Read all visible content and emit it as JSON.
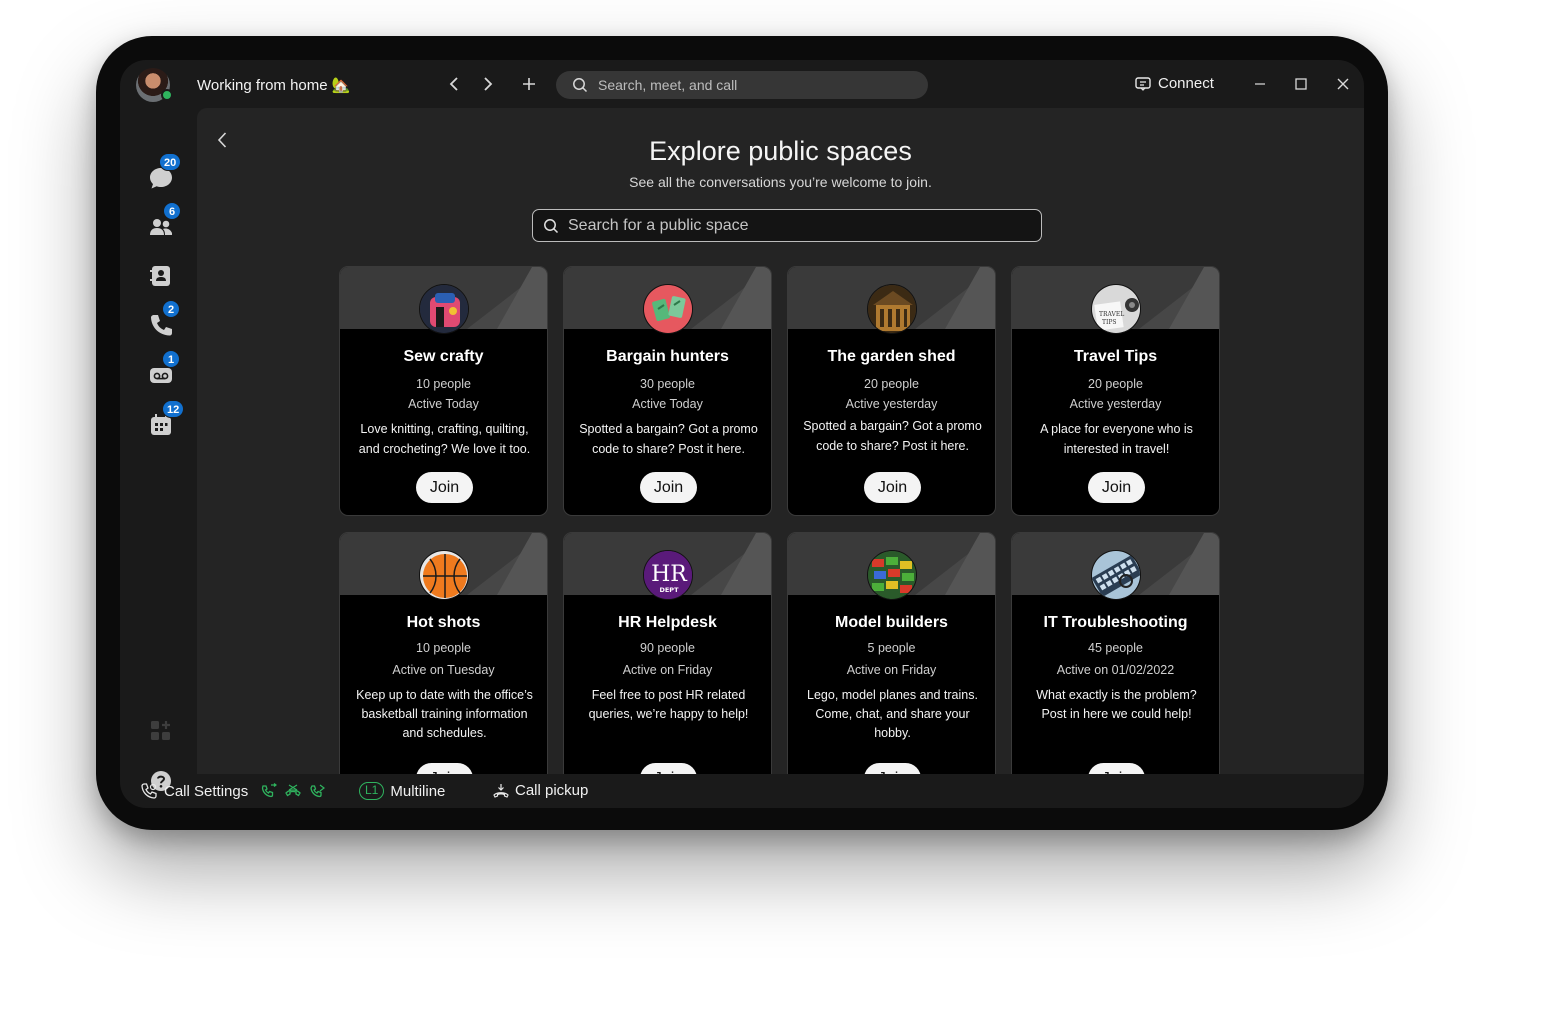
{
  "titlebar": {
    "status": "Working from home 🏡",
    "search_placeholder": "Search, meet, and call",
    "connect_label": "Connect"
  },
  "sidebar": {
    "items": [
      {
        "name": "messaging",
        "icon": "chat-icon",
        "badge": "20"
      },
      {
        "name": "teams",
        "icon": "people-icon",
        "badge": "6"
      },
      {
        "name": "contacts",
        "icon": "contacts-icon",
        "badge": ""
      },
      {
        "name": "calling",
        "icon": "phone-icon",
        "badge": "2"
      },
      {
        "name": "voicemail",
        "icon": "voicemail-icon",
        "badge": "1"
      },
      {
        "name": "meetings",
        "icon": "calendar-icon",
        "badge": "12"
      }
    ],
    "bottom": [
      {
        "name": "apps",
        "icon": "apps-icon"
      },
      {
        "name": "help",
        "icon": "help-icon"
      }
    ]
  },
  "main": {
    "title": "Explore public spaces",
    "subtitle": "See all the conversations you’re welcome to join.",
    "search_placeholder": "Search for a public space",
    "join_label": "Join",
    "spaces": [
      {
        "name": "Sew crafty",
        "people": "10 people",
        "active": "Active Today",
        "desc": "Love knitting, crafting, quilting, and crocheting? We love it too.",
        "icon": "sewing-machine-icon"
      },
      {
        "name": "Bargain hunters",
        "people": "30 people",
        "active": "Active Today",
        "desc": "Spotted a bargain? Got a promo code to share? Post it here.",
        "icon": "shopping-icon"
      },
      {
        "name": "The garden shed",
        "people": "20 people",
        "active": "Active yesterday",
        "desc": "Spotted a bargain? Got a promo code to share? Post it here.",
        "icon": "shed-icon"
      },
      {
        "name": "Travel Tips",
        "people": "20 people",
        "active": "Active yesterday",
        "desc": "A place for everyone who is interested in travel!",
        "icon": "travel-icon"
      },
      {
        "name": "Hot shots",
        "people": "10 people",
        "active": "Active on Tuesday",
        "desc": "Keep up to date with the office’s basketball training information and schedules.",
        "icon": "basketball-icon"
      },
      {
        "name": "HR Helpdesk",
        "people": "90 people",
        "active": "Active on Friday",
        "desc": "Feel free to post HR related queries, we’re happy to help!",
        "icon": "hr-dept-icon"
      },
      {
        "name": "Model builders",
        "people": "5 people",
        "active": "Active on Friday",
        "desc": "Lego, model planes and trains. Come, chat, and share your hobby.",
        "icon": "lego-icon"
      },
      {
        "name": "IT Troubleshooting",
        "people": "45 people",
        "active": "Active on 01/02/2022",
        "desc": "What exactly is the problem? Post in here we could help!",
        "icon": "keyboard-icon"
      }
    ],
    "hr_logo": {
      "big": "HR",
      "small": "DEPT"
    },
    "travel_logo": {
      "line1": "TRAVEL",
      "line2": "TIPS"
    }
  },
  "bottombar": {
    "call_settings": "Call Settings",
    "line_badge": "L1",
    "multiline": "Multiline",
    "call_pickup": "Call pickup"
  },
  "colors": {
    "accent_badge": "#1170cf",
    "presence": "#2fb35e",
    "background": "#242424"
  }
}
